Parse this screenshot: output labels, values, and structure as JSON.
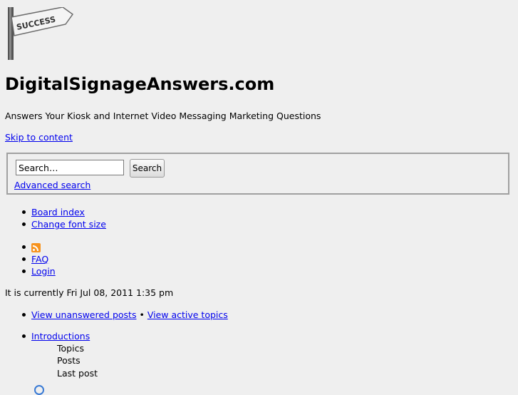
{
  "header": {
    "logo_text": "SUCCESS",
    "site_title": "DigitalSignageAnswers.com",
    "tagline": "Answers Your Kiosk and Internet Video Messaging Marketing Questions",
    "skip_link": "Skip to content"
  },
  "search": {
    "input_value": "Search…",
    "button_label": "Search",
    "advanced_link": "Advanced search"
  },
  "nav_primary": [
    {
      "label": "Board index"
    },
    {
      "label": "Change font size"
    }
  ],
  "nav_secondary": {
    "rss_icon": "rss-feed-icon",
    "faq": "FAQ",
    "login": "Login"
  },
  "current_time": "It is currently Fri Jul 08, 2011 1:35 pm",
  "quick_links": {
    "unanswered": "View unanswered posts",
    "separator": "•",
    "active": "View active topics"
  },
  "forum": {
    "name": "Introductions",
    "topics_label": "Topics",
    "posts_label": "Posts",
    "last_post_label": "Last post"
  }
}
